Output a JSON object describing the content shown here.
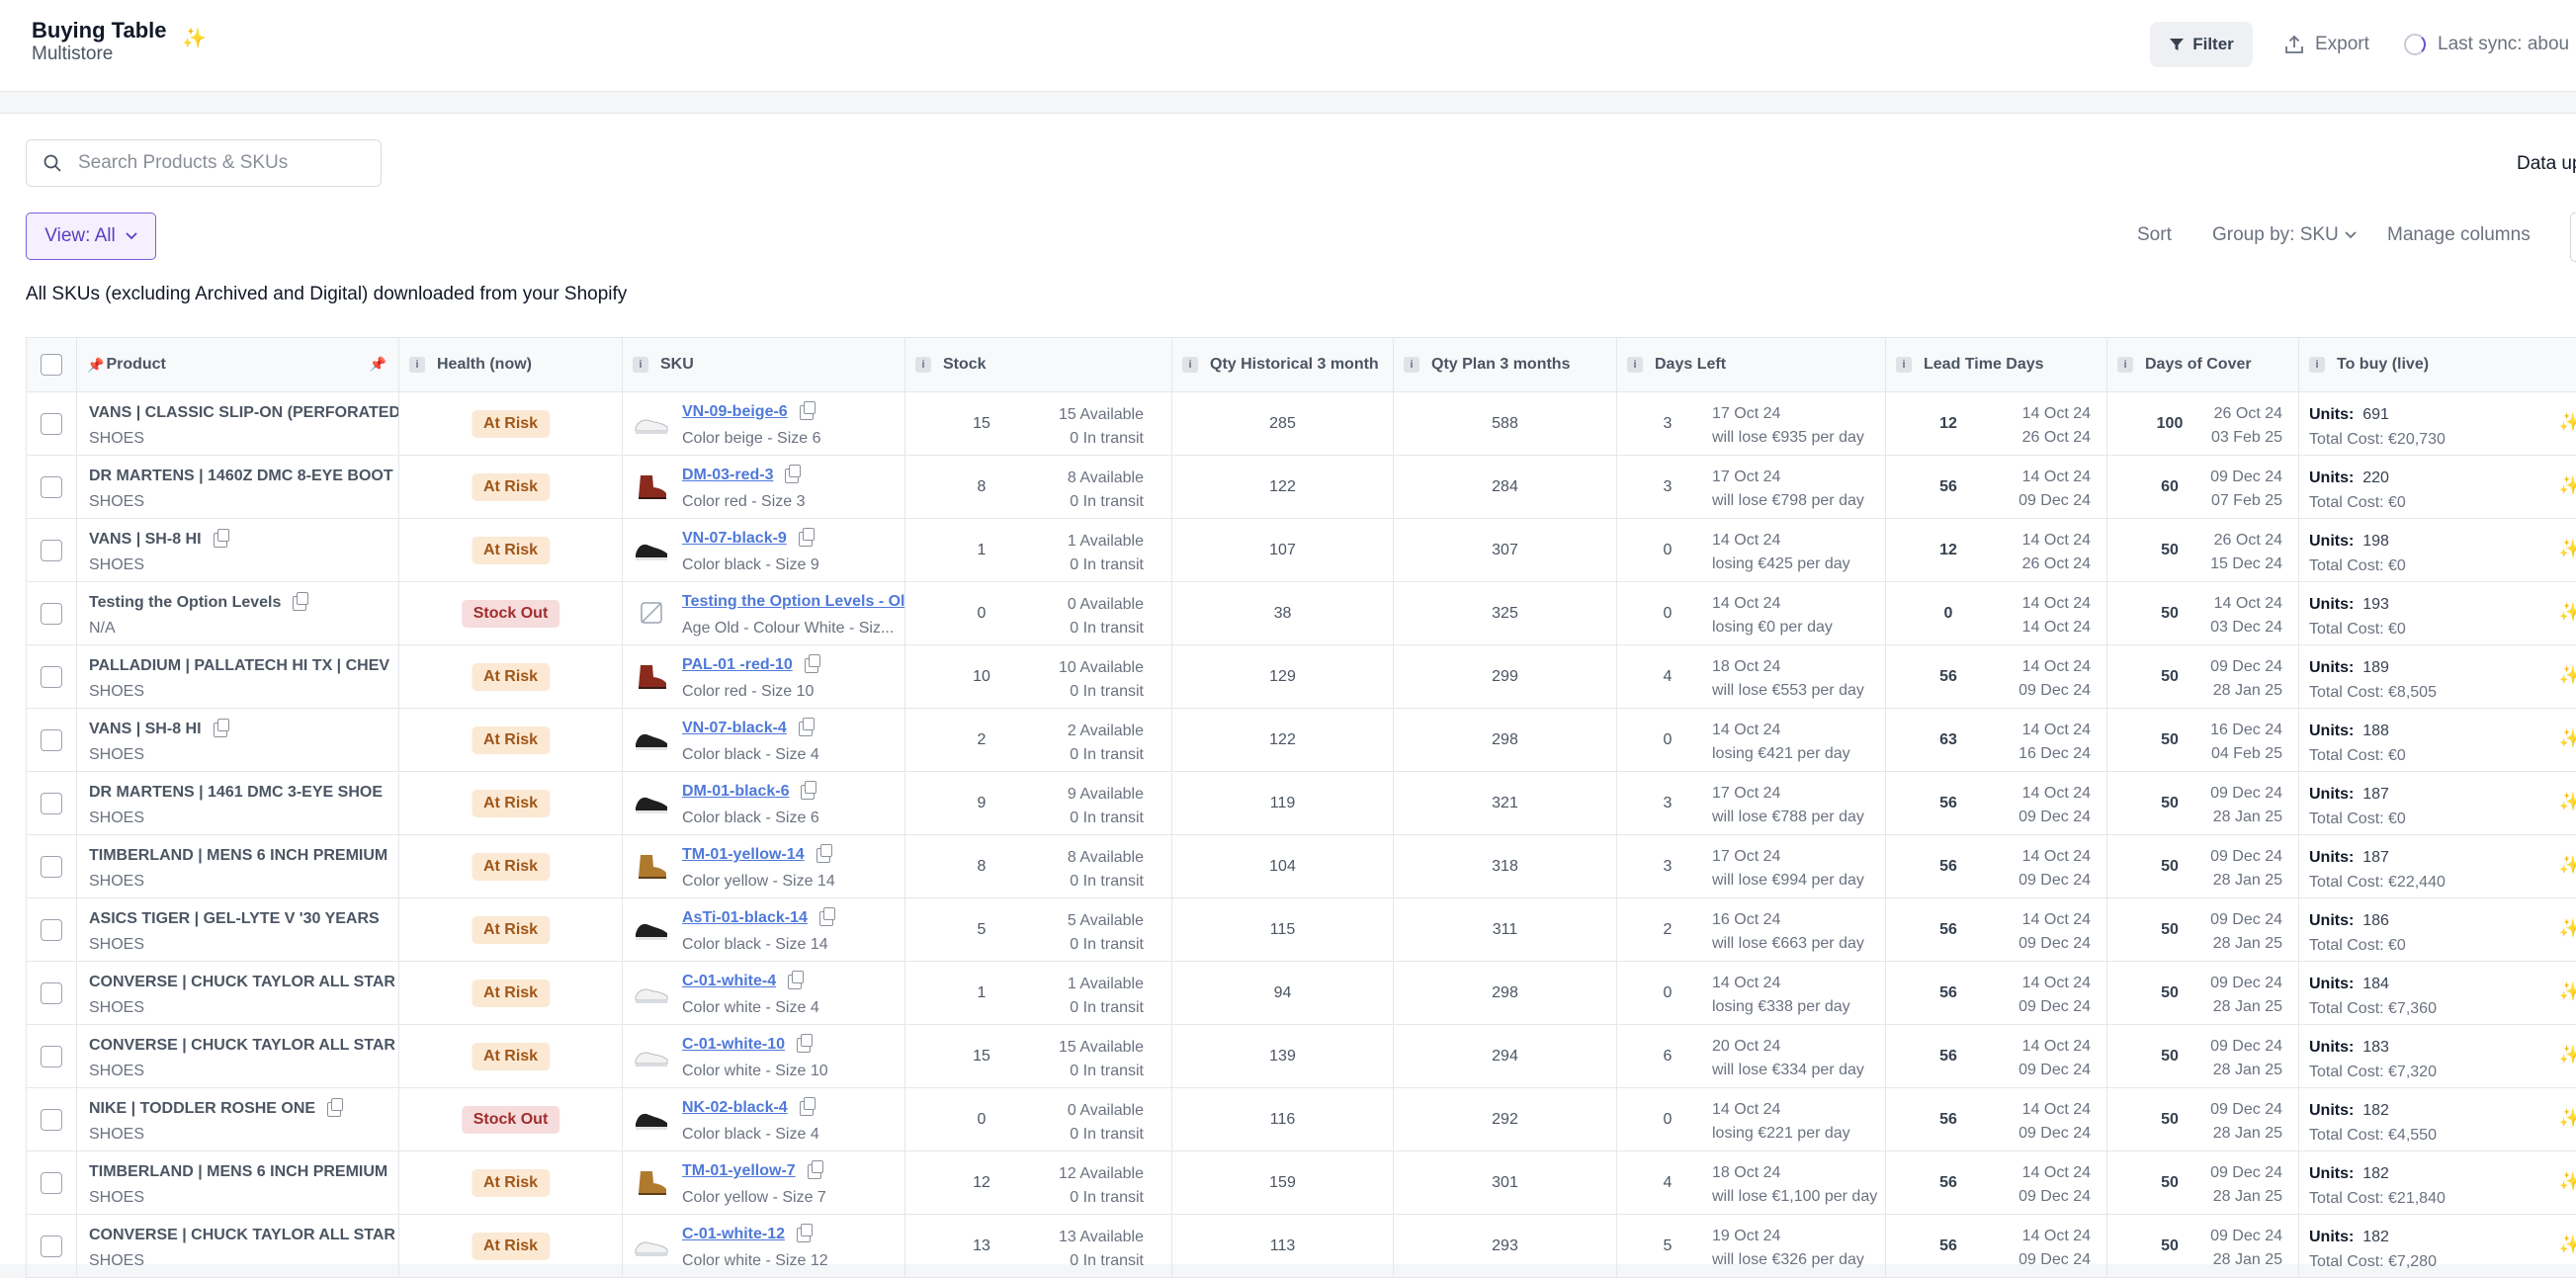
{
  "header": {
    "title": "Buying Table",
    "subtitle": "Multistore",
    "filter_label": "Filter",
    "export_label": "Export",
    "sync_label": "Last sync: abou"
  },
  "toolbar": {
    "search_placeholder": "Search Products & SKUs",
    "data_updated": "Data up",
    "view_label": "View: All",
    "sort_label": "Sort",
    "group_label": "Group by: SKU",
    "manage_label": "Manage columns",
    "description": "All SKUs (excluding Archived and Digital) downloaded from your Shopify"
  },
  "columns": {
    "product": "Product",
    "health": "Health (now)",
    "sku": "SKU",
    "stock": "Stock",
    "qty_hist": "Qty Historical 3 month",
    "qty_plan": "Qty Plan 3 months",
    "days_left": "Days Left",
    "lead_time": "Lead Time Days",
    "days_cover": "Days of Cover",
    "to_buy": "To buy (live)"
  },
  "colors": {
    "accent": "#7c5ed6",
    "link": "#4f79d9",
    "risk_bg": "#fbe9d4",
    "out_bg": "#f6dcdc"
  },
  "rows": [
    {
      "product": "VANS | CLASSIC SLIP-ON (PERFORATED",
      "copy": false,
      "type": "SHOES",
      "health": "At Risk",
      "status": "risk",
      "shoe": "white",
      "sku": "VN-09-beige-6",
      "variant": "Color beige - Size 6",
      "stock": "15",
      "available": "15 Available",
      "transit": "0 In transit",
      "hist": "285",
      "plan": "588",
      "days_left": "3",
      "dl_date": "17 Oct 24",
      "dl_note": "will lose €935 per day",
      "lead": "12",
      "lt_a": "14 Oct 24",
      "lt_b": "26 Oct 24",
      "cover": "100",
      "dc_a": "26 Oct 24",
      "dc_b": "03 Feb 25",
      "units_label": "Units:",
      "units": "691",
      "cost": "Total Cost: €20,730"
    },
    {
      "product": "DR MARTENS | 1460Z DMC 8-EYE BOOT",
      "copy": false,
      "type": "SHOES",
      "health": "At Risk",
      "status": "risk",
      "shoe": "boot-red",
      "sku": "DM-03-red-3",
      "variant": "Color red - Size 3",
      "stock": "8",
      "available": "8 Available",
      "transit": "0 In transit",
      "hist": "122",
      "plan": "284",
      "days_left": "3",
      "dl_date": "17 Oct 24",
      "dl_note": "will lose €798 per day",
      "lead": "56",
      "lt_a": "14 Oct 24",
      "lt_b": "09 Dec 24",
      "cover": "60",
      "dc_a": "09 Dec 24",
      "dc_b": "07 Feb 25",
      "units_label": "Units:",
      "units": "220",
      "cost": "Total Cost: €0"
    },
    {
      "product": "VANS | SH-8 HI",
      "copy": true,
      "type": "SHOES",
      "health": "At Risk",
      "status": "risk",
      "shoe": "black",
      "sku": "VN-07-black-9",
      "variant": "Color black - Size 9",
      "stock": "1",
      "available": "1 Available",
      "transit": "0 In transit",
      "hist": "107",
      "plan": "307",
      "days_left": "0",
      "dl_date": "14 Oct 24",
      "dl_note": "losing €425 per day",
      "lead": "12",
      "lt_a": "14 Oct 24",
      "lt_b": "26 Oct 24",
      "cover": "50",
      "dc_a": "26 Oct 24",
      "dc_b": "15 Dec 24",
      "units_label": "Units:",
      "units": "198",
      "cost": "Total Cost: €0"
    },
    {
      "product": "Testing the Option Levels",
      "copy": true,
      "type": "N/A",
      "health": "Stock Out",
      "status": "out",
      "shoe": "none",
      "sku": "Testing the Option Levels - Ol",
      "variant": "Age Old - Colour White - Siz...",
      "stock": "0",
      "available": "0 Available",
      "transit": "0 In transit",
      "hist": "38",
      "plan": "325",
      "days_left": "0",
      "dl_date": "14 Oct 24",
      "dl_note": "losing €0 per day",
      "lead": "0",
      "lt_a": "14 Oct 24",
      "lt_b": "14 Oct 24",
      "cover": "50",
      "dc_a": "14 Oct 24",
      "dc_b": "03 Dec 24",
      "units_label": "Units:",
      "units": "193",
      "cost": "Total Cost: €0"
    },
    {
      "product": "PALLADIUM | PALLATECH HI TX | CHEV",
      "copy": false,
      "type": "SHOES",
      "health": "At Risk",
      "status": "risk",
      "shoe": "boot-red",
      "sku": "PAL-01 -red-10",
      "variant": "Color red - Size 10",
      "stock": "10",
      "available": "10 Available",
      "transit": "0 In transit",
      "hist": "129",
      "plan": "299",
      "days_left": "4",
      "dl_date": "18 Oct 24",
      "dl_note": "will lose €553 per day",
      "lead": "56",
      "lt_a": "14 Oct 24",
      "lt_b": "09 Dec 24",
      "cover": "50",
      "dc_a": "09 Dec 24",
      "dc_b": "28 Jan 25",
      "units_label": "Units:",
      "units": "189",
      "cost": "Total Cost: €8,505"
    },
    {
      "product": "VANS | SH-8 HI",
      "copy": true,
      "type": "SHOES",
      "health": "At Risk",
      "status": "risk",
      "shoe": "black",
      "sku": "VN-07-black-4",
      "variant": "Color black - Size 4",
      "stock": "2",
      "available": "2 Available",
      "transit": "0 In transit",
      "hist": "122",
      "plan": "298",
      "days_left": "0",
      "dl_date": "14 Oct 24",
      "dl_note": "losing €421 per day",
      "lead": "63",
      "lt_a": "14 Oct 24",
      "lt_b": "16 Dec 24",
      "cover": "50",
      "dc_a": "16 Dec 24",
      "dc_b": "04 Feb 25",
      "units_label": "Units:",
      "units": "188",
      "cost": "Total Cost: €0"
    },
    {
      "product": "DR MARTENS | 1461 DMC 3-EYE SHOE",
      "copy": false,
      "type": "SHOES",
      "health": "At Risk",
      "status": "risk",
      "shoe": "black",
      "sku": "DM-01-black-6",
      "variant": "Color black - Size 6",
      "stock": "9",
      "available": "9 Available",
      "transit": "0 In transit",
      "hist": "119",
      "plan": "321",
      "days_left": "3",
      "dl_date": "17 Oct 24",
      "dl_note": "will lose €788 per day",
      "lead": "56",
      "lt_a": "14 Oct 24",
      "lt_b": "09 Dec 24",
      "cover": "50",
      "dc_a": "09 Dec 24",
      "dc_b": "28 Jan 25",
      "units_label": "Units:",
      "units": "187",
      "cost": "Total Cost: €0"
    },
    {
      "product": "TIMBERLAND | MENS 6 INCH PREMIUM",
      "copy": false,
      "type": "SHOES",
      "health": "At Risk",
      "status": "risk",
      "shoe": "boot-yellow",
      "sku": "TM-01-yellow-14",
      "variant": "Color yellow - Size 14",
      "stock": "8",
      "available": "8 Available",
      "transit": "0 In transit",
      "hist": "104",
      "plan": "318",
      "days_left": "3",
      "dl_date": "17 Oct 24",
      "dl_note": "will lose €994 per day",
      "lead": "56",
      "lt_a": "14 Oct 24",
      "lt_b": "09 Dec 24",
      "cover": "50",
      "dc_a": "09 Dec 24",
      "dc_b": "28 Jan 25",
      "units_label": "Units:",
      "units": "187",
      "cost": "Total Cost: €22,440"
    },
    {
      "product": "ASICS TIGER | GEL-LYTE V '30 YEARS",
      "copy": false,
      "type": "SHOES",
      "health": "At Risk",
      "status": "risk",
      "shoe": "black",
      "sku": "AsTi-01-black-14",
      "variant": "Color black - Size 14",
      "stock": "5",
      "available": "5 Available",
      "transit": "0 In transit",
      "hist": "115",
      "plan": "311",
      "days_left": "2",
      "dl_date": "16 Oct 24",
      "dl_note": "will lose €663 per day",
      "lead": "56",
      "lt_a": "14 Oct 24",
      "lt_b": "09 Dec 24",
      "cover": "50",
      "dc_a": "09 Dec 24",
      "dc_b": "28 Jan 25",
      "units_label": "Units:",
      "units": "186",
      "cost": "Total Cost: €0"
    },
    {
      "product": "CONVERSE | CHUCK TAYLOR ALL STAR",
      "copy": false,
      "type": "SHOES",
      "health": "At Risk",
      "status": "risk",
      "shoe": "white",
      "sku": "C-01-white-4",
      "variant": "Color white - Size 4",
      "stock": "1",
      "available": "1 Available",
      "transit": "0 In transit",
      "hist": "94",
      "plan": "298",
      "days_left": "0",
      "dl_date": "14 Oct 24",
      "dl_note": "losing €338 per day",
      "lead": "56",
      "lt_a": "14 Oct 24",
      "lt_b": "09 Dec 24",
      "cover": "50",
      "dc_a": "09 Dec 24",
      "dc_b": "28 Jan 25",
      "units_label": "Units:",
      "units": "184",
      "cost": "Total Cost: €7,360"
    },
    {
      "product": "CONVERSE | CHUCK TAYLOR ALL STAR",
      "copy": false,
      "type": "SHOES",
      "health": "At Risk",
      "status": "risk",
      "shoe": "white",
      "sku": "C-01-white-10",
      "variant": "Color white - Size 10",
      "stock": "15",
      "available": "15 Available",
      "transit": "0 In transit",
      "hist": "139",
      "plan": "294",
      "days_left": "6",
      "dl_date": "20 Oct 24",
      "dl_note": "will lose €334 per day",
      "lead": "56",
      "lt_a": "14 Oct 24",
      "lt_b": "09 Dec 24",
      "cover": "50",
      "dc_a": "09 Dec 24",
      "dc_b": "28 Jan 25",
      "units_label": "Units:",
      "units": "183",
      "cost": "Total Cost: €7,320"
    },
    {
      "product": "NIKE | TODDLER ROSHE ONE",
      "copy": true,
      "type": "SHOES",
      "health": "Stock Out",
      "status": "out",
      "shoe": "black",
      "sku": "NK-02-black-4",
      "variant": "Color black - Size 4",
      "stock": "0",
      "available": "0 Available",
      "transit": "0 In transit",
      "hist": "116",
      "plan": "292",
      "days_left": "0",
      "dl_date": "14 Oct 24",
      "dl_note": "losing €221 per day",
      "lead": "56",
      "lt_a": "14 Oct 24",
      "lt_b": "09 Dec 24",
      "cover": "50",
      "dc_a": "09 Dec 24",
      "dc_b": "28 Jan 25",
      "units_label": "Units:",
      "units": "182",
      "cost": "Total Cost: €4,550"
    },
    {
      "product": "TIMBERLAND | MENS 6 INCH PREMIUM",
      "copy": false,
      "type": "SHOES",
      "health": "At Risk",
      "status": "risk",
      "shoe": "boot-yellow",
      "sku": "TM-01-yellow-7",
      "variant": "Color yellow - Size 7",
      "stock": "12",
      "available": "12 Available",
      "transit": "0 In transit",
      "hist": "159",
      "plan": "301",
      "days_left": "4",
      "dl_date": "18 Oct 24",
      "dl_note": "will lose €1,100 per day",
      "lead": "56",
      "lt_a": "14 Oct 24",
      "lt_b": "09 Dec 24",
      "cover": "50",
      "dc_a": "09 Dec 24",
      "dc_b": "28 Jan 25",
      "units_label": "Units:",
      "units": "182",
      "cost": "Total Cost: €21,840"
    },
    {
      "product": "CONVERSE | CHUCK TAYLOR ALL STAR",
      "copy": false,
      "type": "SHOES",
      "health": "At Risk",
      "status": "risk",
      "shoe": "white",
      "sku": "C-01-white-12",
      "variant": "Color white - Size 12",
      "stock": "13",
      "available": "13 Available",
      "transit": "0 In transit",
      "hist": "113",
      "plan": "293",
      "days_left": "5",
      "dl_date": "19 Oct 24",
      "dl_note": "will lose €326 per day",
      "lead": "56",
      "lt_a": "14 Oct 24",
      "lt_b": "09 Dec 24",
      "cover": "50",
      "dc_a": "09 Dec 24",
      "dc_b": "28 Jan 25",
      "units_label": "Units:",
      "units": "182",
      "cost": "Total Cost: €7,280"
    }
  ]
}
